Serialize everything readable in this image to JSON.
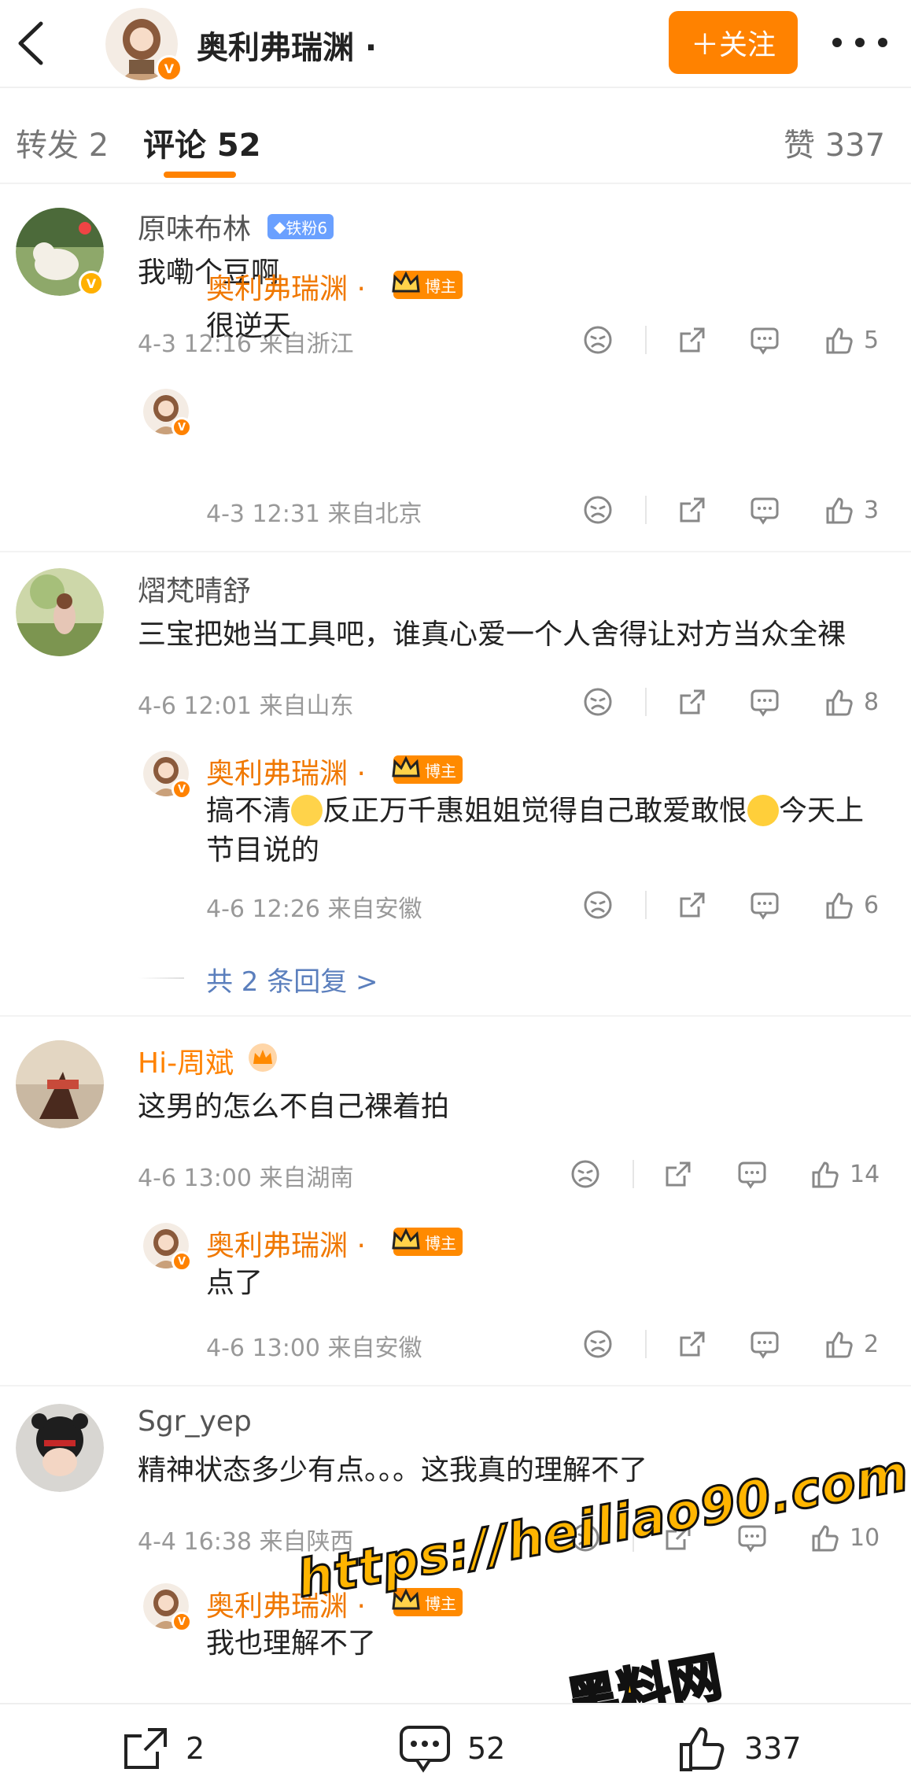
{
  "header": {
    "author_name": "奥利弗瑞渊 ·",
    "follow_label": "＋关注"
  },
  "tabs": {
    "repost": "转发 2",
    "comments": "评论 52",
    "likes": "赞 337"
  },
  "comments": [
    {
      "user": "原味布林",
      "badge": "铁粉6",
      "text": "我嘞个豆啊",
      "meta": "4-3 12:16  来自浙江",
      "likes": "5",
      "reply": {
        "user": "奥利弗瑞渊 ·",
        "badge": "博主",
        "text": "很逆天",
        "meta": "4-3 12:31  来自北京",
        "likes": "3"
      }
    },
    {
      "user": "熠梵晴舒",
      "text": "三宝把她当工具吧，谁真心爱一个人舍得让对方当众全裸",
      "meta": "4-6 12:01  来自山东",
      "likes": "8",
      "reply": {
        "user": "奥利弗瑞渊 ·",
        "badge": "博主",
        "text_a": "搞不清",
        "text_b": "反正万千惠姐姐觉得自己敢爱敢恨",
        "text_c": "今天上节目说的",
        "meta": "4-6 12:26  来自安徽",
        "likes": "6"
      },
      "more_replies": "共 2 条回复 >"
    },
    {
      "user": "Hi-周斌",
      "text": "这男的怎么不自己裸着拍",
      "meta": "4-6 13:00  来自湖南",
      "likes": "14",
      "reply": {
        "user": "奥利弗瑞渊 ·",
        "badge": "博主",
        "text": "点了",
        "meta": "4-6 13:00  来自安徽",
        "likes": "2"
      }
    },
    {
      "user": "Sgr_yep",
      "text": "精神状态多少有点。。。这我真的理解不了",
      "meta": "4-4 16:38  来自陕西",
      "likes": "10",
      "reply": {
        "user": "奥利弗瑞渊 ·",
        "badge": "博主",
        "text": "我也理解不了"
      }
    }
  ],
  "bottombar": {
    "reposts": "2",
    "comments": "52",
    "likes": "337"
  },
  "watermark": {
    "url": "https://heiliao90.com",
    "cn": "黑料网"
  },
  "colors": {
    "accent": "#ff8200",
    "link": "#5b7fbd",
    "meta": "#999999"
  },
  "icons": [
    "back-icon",
    "more-icon",
    "dislike-icon",
    "share-icon",
    "comment-icon",
    "like-icon",
    "crown-icon",
    "verified-icon"
  ]
}
